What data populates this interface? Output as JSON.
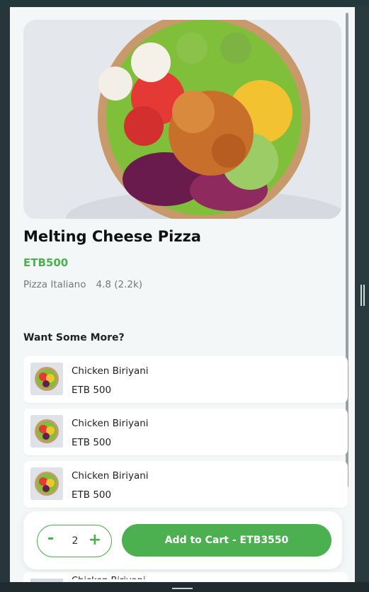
{
  "product": {
    "title": "Melting Cheese Pizza",
    "price": "ETB500",
    "restaurant": "Pizza Italiano",
    "rating": "4.8 (2.2k)",
    "hero_image": "salad-bowl-image"
  },
  "more_section": {
    "title": "Want Some More?",
    "items": [
      {
        "name": "Chicken Biriyani",
        "price": "ETB  500"
      },
      {
        "name": "Chicken Biriyani",
        "price": "ETB  500"
      },
      {
        "name": "Chicken Biriyani",
        "price": "ETB  500"
      },
      {
        "name": "Chicken Biriyani",
        "price": ""
      }
    ]
  },
  "cart": {
    "minus_label": "-",
    "quantity": "2",
    "plus_label": "+",
    "add_label": "Add to Cart - ETB3550"
  },
  "colors": {
    "accent": "#4caf50",
    "panel_bg": "#f4f7f8",
    "window_bg": "#26363a"
  }
}
